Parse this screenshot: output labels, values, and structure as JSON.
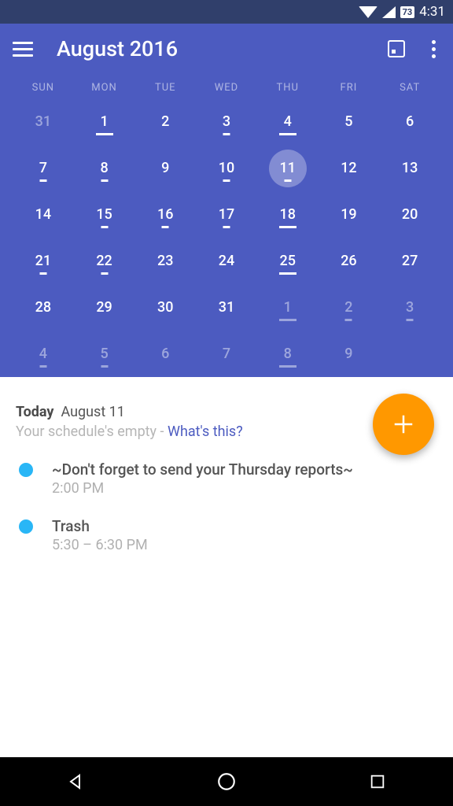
{
  "status": {
    "battery": "73",
    "time": "4:31"
  },
  "header": {
    "title": "August 2016"
  },
  "dow": [
    "SUN",
    "MON",
    "TUE",
    "WED",
    "THU",
    "FRI",
    "SAT"
  ],
  "weeks": [
    [
      {
        "n": "31",
        "fade": true
      },
      {
        "n": "1",
        "dash": true,
        "wide": true
      },
      {
        "n": "2"
      },
      {
        "n": "3",
        "dash": true
      },
      {
        "n": "4",
        "dash": true,
        "wide": true
      },
      {
        "n": "5"
      },
      {
        "n": "6"
      }
    ],
    [
      {
        "n": "7",
        "dash": true
      },
      {
        "n": "8",
        "dash": true
      },
      {
        "n": "9"
      },
      {
        "n": "10",
        "dash": true
      },
      {
        "n": "11",
        "dash": true,
        "today": true
      },
      {
        "n": "12"
      },
      {
        "n": "13"
      }
    ],
    [
      {
        "n": "14"
      },
      {
        "n": "15",
        "dash": true
      },
      {
        "n": "16",
        "dash": true
      },
      {
        "n": "17",
        "dash": true
      },
      {
        "n": "18",
        "dash": true,
        "wide": true
      },
      {
        "n": "19"
      },
      {
        "n": "20"
      }
    ],
    [
      {
        "n": "21",
        "dash": true
      },
      {
        "n": "22",
        "dash": true
      },
      {
        "n": "23"
      },
      {
        "n": "24"
      },
      {
        "n": "25",
        "dash": true,
        "wide": true
      },
      {
        "n": "26"
      },
      {
        "n": "27"
      }
    ],
    [
      {
        "n": "28"
      },
      {
        "n": "29"
      },
      {
        "n": "30"
      },
      {
        "n": "31"
      },
      {
        "n": "1",
        "fade": true,
        "dash": true,
        "wide": true
      },
      {
        "n": "2",
        "fade": true,
        "dash": true
      },
      {
        "n": "3",
        "fade": true,
        "dash": true
      }
    ],
    [
      {
        "n": "4",
        "fade": true,
        "dash": true
      },
      {
        "n": "5",
        "fade": true,
        "dash": true
      },
      {
        "n": "6",
        "fade": true
      },
      {
        "n": "7",
        "fade": true
      },
      {
        "n": "8",
        "fade": true,
        "dash": true,
        "wide": true
      },
      {
        "n": "9",
        "fade": true
      },
      {
        "n": "",
        "fade": true
      }
    ]
  ],
  "agenda": {
    "today_label": "Today",
    "today_date": "August 11",
    "empty_text": "Your schedule's empty - ",
    "empty_link": "What's this?",
    "events": [
      {
        "title": "~Don't forget to send your Thursday reports~",
        "time": "2:00 PM"
      },
      {
        "title": "Trash",
        "time": "5:30 – 6:30 PM"
      }
    ]
  }
}
